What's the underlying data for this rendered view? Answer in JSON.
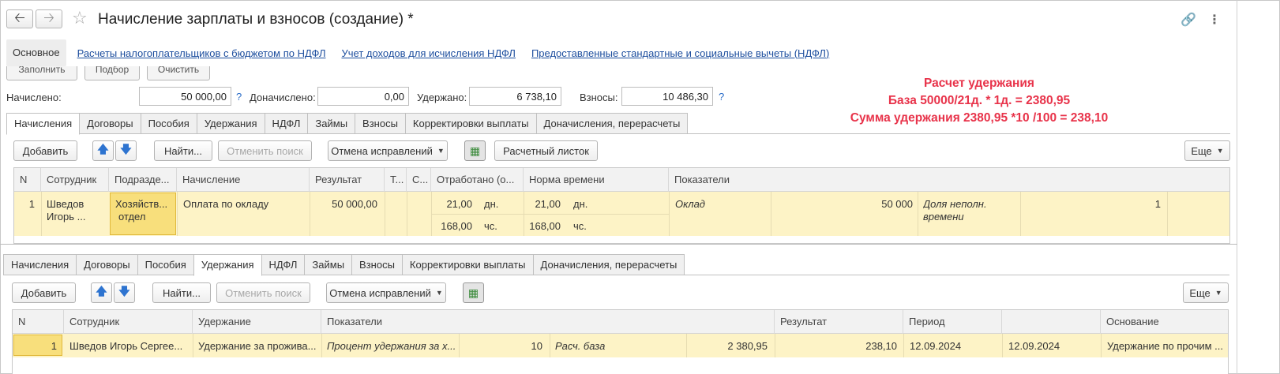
{
  "window": {
    "title": "Начисление зарплаты и взносов (создание) *",
    "back_icon": "arrow-left-icon",
    "forward_icon": "arrow-right-icon",
    "star_icon": "star-icon",
    "link_icon": "link-icon",
    "more_icon": "vertical-dots-icon"
  },
  "nav": {
    "main": "Основное",
    "links": [
      "Расчеты налогоплательщиков с бюджетом по НДФЛ",
      "Учет доходов для исчисления НДФЛ",
      "Предоставленные стандартные и социальные вычеты (НДФЛ)"
    ]
  },
  "partial_buttons": [
    "Заполнить",
    "Подбор",
    "Очистить"
  ],
  "totals": {
    "accrued_label": "Начислено:",
    "accrued_value": "50 000,00",
    "additional_label": "Доначислено:",
    "additional_value": "0,00",
    "withheld_label": "Удержано:",
    "withheld_value": "6 738,10",
    "contributions_label": "Взносы:",
    "contributions_value": "10 486,30",
    "help_mark": "?"
  },
  "annotation": {
    "line1": "Расчет удержания",
    "line2": "База 50000/21д. * 1д. = 2380,95",
    "line3": "Сумма удержания 2380,95 *10 /100 = 238,10"
  },
  "tabs": [
    "Начисления",
    "Договоры",
    "Пособия",
    "Удержания",
    "НДФЛ",
    "Займы",
    "Взносы",
    "Корректировки выплаты",
    "Доначисления, перерасчеты"
  ],
  "toolbar": {
    "add": "Добавить",
    "up_icon": "arrow-up-icon",
    "down_icon": "arrow-down-icon",
    "find": "Найти...",
    "cancel_search": "Отменить поиск",
    "cancel_corrections": "Отмена исправлений",
    "grid_toggle_icon": "table-settings-icon",
    "payslip": "Расчетный листок",
    "more": "Еще"
  },
  "accruals_grid": {
    "headers": [
      "N",
      "Сотрудник",
      "Подразде...",
      "Начисление",
      "Результат",
      "Т...",
      "С...",
      "Отработано (о...",
      "Норма времени",
      "Показатели"
    ],
    "row": {
      "n": "1",
      "employee_line1": "Шведов",
      "employee_line2": "Игорь ...",
      "department_line1": "Хозяйств...",
      "department_line2": "отдел",
      "accrual": "Оплата по окладу",
      "result": "50 000,00",
      "worked_days": "21,00",
      "worked_days_unit": "дн.",
      "norm_days": "21,00",
      "norm_days_unit": "дн.",
      "worked_hours": "168,00",
      "worked_hours_unit": "чс.",
      "norm_hours": "168,00",
      "norm_hours_unit": "чс.",
      "indicator1_name": "Оклад",
      "indicator1_value": "50 000",
      "indicator2_name_line1": "Доля неполн.",
      "indicator2_name_line2": "времени",
      "indicator2_value": "1"
    }
  },
  "deductions_grid": {
    "headers": [
      "N",
      "Сотрудник",
      "Удержание",
      "Показатели",
      "Результат",
      "Период",
      "",
      "Основание"
    ],
    "row": {
      "n": "1",
      "employee": "Шведов Игорь Сергее...",
      "deduction": "Удержание за прожива...",
      "indicator1_name": "Процент удержания за х...",
      "indicator1_value": "10",
      "indicator2_name": "Расч. база",
      "indicator2_value": "2 380,95",
      "result": "238,10",
      "period": "12.09.2024",
      "period2": "12.09.2024",
      "basis": "Удержание по прочим ..."
    }
  }
}
